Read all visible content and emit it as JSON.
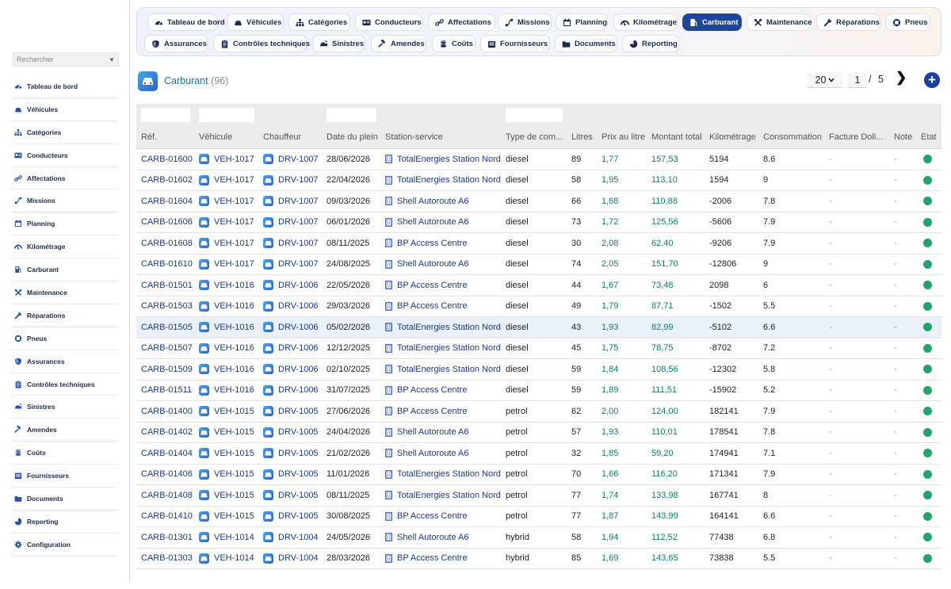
{
  "sidebar": {
    "search_placeholder": "Rechercher",
    "items": [
      {
        "label": "Tableau de bord",
        "icon": "dashboard-icon"
      },
      {
        "label": "Véhicules",
        "icon": "car-icon"
      },
      {
        "label": "Catégories",
        "icon": "sitemap-icon"
      },
      {
        "label": "Conducteurs",
        "icon": "id-card-icon"
      },
      {
        "label": "Affectations",
        "icon": "link-icon"
      },
      {
        "label": "Missions",
        "icon": "route-icon"
      },
      {
        "label": "Planning",
        "icon": "calendar-icon"
      },
      {
        "label": "Kilométrage",
        "icon": "gauge-icon"
      },
      {
        "label": "Carburant",
        "icon": "fuel-pump-icon"
      },
      {
        "label": "Maintenance",
        "icon": "tools-icon"
      },
      {
        "label": "Réparations",
        "icon": "wrench-icon"
      },
      {
        "label": "Pneus",
        "icon": "tire-icon"
      },
      {
        "label": "Assurances",
        "icon": "shield-icon"
      },
      {
        "label": "Contrôles techniques",
        "icon": "clipboard-icon"
      },
      {
        "label": "Sinistres",
        "icon": "car-crash-icon"
      },
      {
        "label": "Amendes",
        "icon": "gavel-icon"
      },
      {
        "label": "Coûts",
        "icon": "coins-icon"
      },
      {
        "label": "Fournisseurs",
        "icon": "warehouse-icon"
      },
      {
        "label": "Documents",
        "icon": "folder-icon"
      },
      {
        "label": "Reporting",
        "icon": "chart-pie-icon"
      },
      {
        "label": "Configuration",
        "icon": "gear-icon"
      }
    ]
  },
  "tabs": [
    {
      "label": "Tableau de bord",
      "icon": "dashboard-icon",
      "active": false
    },
    {
      "label": "Véhicules",
      "icon": "car-icon",
      "active": false
    },
    {
      "label": "Catégories",
      "icon": "sitemap-icon",
      "active": false
    },
    {
      "label": "Conducteurs",
      "icon": "id-card-icon",
      "active": false
    },
    {
      "label": "Affectations",
      "icon": "link-icon",
      "active": false
    },
    {
      "label": "Missions",
      "icon": "route-icon",
      "active": false
    },
    {
      "label": "Planning",
      "icon": "calendar-icon",
      "active": false
    },
    {
      "label": "Kilométrage",
      "icon": "gauge-icon",
      "active": false
    },
    {
      "label": "Carburant",
      "icon": "fuel-pump-icon",
      "active": true
    },
    {
      "label": "Maintenance",
      "icon": "tools-icon",
      "active": false
    },
    {
      "label": "Réparations",
      "icon": "wrench-icon",
      "active": false
    },
    {
      "label": "Pneus",
      "icon": "tire-icon",
      "active": false
    },
    {
      "label": "Assurances",
      "icon": "shield-icon",
      "active": false
    },
    {
      "label": "Contrôles techniques",
      "icon": "clipboard-icon",
      "active": false
    },
    {
      "label": "Sinistres",
      "icon": "car-crash-icon",
      "active": false
    },
    {
      "label": "Amendes",
      "icon": "gavel-icon",
      "active": false
    },
    {
      "label": "Coûts",
      "icon": "coins-icon",
      "active": false
    },
    {
      "label": "Fournisseurs",
      "icon": "warehouse-icon",
      "active": false
    },
    {
      "label": "Documents",
      "icon": "folder-icon",
      "active": false
    },
    {
      "label": "Reporting",
      "icon": "chart-pie-icon",
      "active": false
    }
  ],
  "page": {
    "title": "Carburant",
    "count": "(96)",
    "page_size": "20",
    "current_page": "1",
    "page_sep": "/",
    "total_pages": "5",
    "next_glyph": "❯",
    "add_glyph": "+"
  },
  "table": {
    "columns": [
      "Réf.",
      "Véhicule",
      "Chauffeur",
      "Date du plein",
      "Station-service",
      "Type de com...",
      "Litres",
      "Prix au litre",
      "Montant total",
      "Kilométrage",
      "Consommation",
      "Facture Doli...",
      "Note",
      "État"
    ],
    "status_color": "#21a36b",
    "rows": [
      {
        "ref": "CARB-01600",
        "vehicle": "VEH-1017",
        "driver": "DRV-1007",
        "date": "28/06/2026",
        "station": "TotalEnergies Station Nord",
        "fuel": "diesel",
        "liters": "89",
        "price": "1,77",
        "total": "157,53",
        "km": "5194",
        "conso": "8.6",
        "invoice": "-",
        "note": "-"
      },
      {
        "ref": "CARB-01602",
        "vehicle": "VEH-1017",
        "driver": "DRV-1007",
        "date": "22/04/2026",
        "station": "TotalEnergies Station Nord",
        "fuel": "diesel",
        "liters": "58",
        "price": "1,95",
        "total": "113,10",
        "km": "1594",
        "conso": "9",
        "invoice": "-",
        "note": "-"
      },
      {
        "ref": "CARB-01604",
        "vehicle": "VEH-1017",
        "driver": "DRV-1007",
        "date": "09/03/2026",
        "station": "Shell Autoroute A6",
        "fuel": "diesel",
        "liters": "66",
        "price": "1,68",
        "total": "110,88",
        "km": "-2006",
        "conso": "7.8",
        "invoice": "-",
        "note": "-"
      },
      {
        "ref": "CARB-01606",
        "vehicle": "VEH-1017",
        "driver": "DRV-1007",
        "date": "06/01/2026",
        "station": "Shell Autoroute A6",
        "fuel": "diesel",
        "liters": "73",
        "price": "1,72",
        "total": "125,56",
        "km": "-5606",
        "conso": "7.9",
        "invoice": "-",
        "note": "-"
      },
      {
        "ref": "CARB-01608",
        "vehicle": "VEH-1017",
        "driver": "DRV-1007",
        "date": "08/11/2025",
        "station": "BP Access Centre",
        "fuel": "diesel",
        "liters": "30",
        "price": "2,08",
        "total": "62,40",
        "km": "-9206",
        "conso": "7.9",
        "invoice": "-",
        "note": "-"
      },
      {
        "ref": "CARB-01610",
        "vehicle": "VEH-1017",
        "driver": "DRV-1007",
        "date": "24/08/2025",
        "station": "Shell Autoroute A6",
        "fuel": "diesel",
        "liters": "74",
        "price": "2,05",
        "total": "151,70",
        "km": "-12806",
        "conso": "9",
        "invoice": "-",
        "note": "-"
      },
      {
        "ref": "CARB-01501",
        "vehicle": "VEH-1016",
        "driver": "DRV-1006",
        "date": "22/05/2026",
        "station": "BP Access Centre",
        "fuel": "diesel",
        "liters": "44",
        "price": "1,67",
        "total": "73,48",
        "km": "2098",
        "conso": "6",
        "invoice": "-",
        "note": "-"
      },
      {
        "ref": "CARB-01503",
        "vehicle": "VEH-1016",
        "driver": "DRV-1006",
        "date": "29/03/2026",
        "station": "BP Access Centre",
        "fuel": "diesel",
        "liters": "49",
        "price": "1,79",
        "total": "87,71",
        "km": "-1502",
        "conso": "5.5",
        "invoice": "-",
        "note": "-"
      },
      {
        "ref": "CARB-01505",
        "vehicle": "VEH-1016",
        "driver": "DRV-1006",
        "date": "05/02/2026",
        "station": "TotalEnergies Station Nord",
        "fuel": "diesel",
        "liters": "43",
        "price": "1,93",
        "total": "82,99",
        "km": "-5102",
        "conso": "6.6",
        "invoice": "-",
        "note": "-"
      },
      {
        "ref": "CARB-01507",
        "vehicle": "VEH-1016",
        "driver": "DRV-1006",
        "date": "12/12/2025",
        "station": "TotalEnergies Station Nord",
        "fuel": "diesel",
        "liters": "45",
        "price": "1,75",
        "total": "78,75",
        "km": "-8702",
        "conso": "7.2",
        "invoice": "-",
        "note": "-"
      },
      {
        "ref": "CARB-01509",
        "vehicle": "VEH-1016",
        "driver": "DRV-1006",
        "date": "02/10/2025",
        "station": "TotalEnergies Station Nord",
        "fuel": "diesel",
        "liters": "59",
        "price": "1,84",
        "total": "108,56",
        "km": "-12302",
        "conso": "5.8",
        "invoice": "-",
        "note": "-"
      },
      {
        "ref": "CARB-01511",
        "vehicle": "VEH-1016",
        "driver": "DRV-1006",
        "date": "31/07/2025",
        "station": "BP Access Centre",
        "fuel": "diesel",
        "liters": "59",
        "price": "1,89",
        "total": "111,51",
        "km": "-15902",
        "conso": "5.2",
        "invoice": "-",
        "note": "-"
      },
      {
        "ref": "CARB-01400",
        "vehicle": "VEH-1015",
        "driver": "DRV-1005",
        "date": "27/06/2026",
        "station": "BP Access Centre",
        "fuel": "petrol",
        "liters": "62",
        "price": "2,00",
        "total": "124,00",
        "km": "182141",
        "conso": "7.9",
        "invoice": "-",
        "note": "-"
      },
      {
        "ref": "CARB-01402",
        "vehicle": "VEH-1015",
        "driver": "DRV-1005",
        "date": "24/04/2026",
        "station": "Shell Autoroute A6",
        "fuel": "petrol",
        "liters": "57",
        "price": "1,93",
        "total": "110,01",
        "km": "178541",
        "conso": "7.8",
        "invoice": "-",
        "note": "-"
      },
      {
        "ref": "CARB-01404",
        "vehicle": "VEH-1015",
        "driver": "DRV-1005",
        "date": "21/02/2026",
        "station": "Shell Autoroute A6",
        "fuel": "petrol",
        "liters": "32",
        "price": "1,85",
        "total": "59,20",
        "km": "174941",
        "conso": "7.1",
        "invoice": "-",
        "note": "-"
      },
      {
        "ref": "CARB-01406",
        "vehicle": "VEH-1015",
        "driver": "DRV-1005",
        "date": "11/01/2026",
        "station": "TotalEnergies Station Nord",
        "fuel": "petrol",
        "liters": "70",
        "price": "1,66",
        "total": "116,20",
        "km": "171341",
        "conso": "7.9",
        "invoice": "-",
        "note": "-"
      },
      {
        "ref": "CARB-01408",
        "vehicle": "VEH-1015",
        "driver": "DRV-1005",
        "date": "08/11/2025",
        "station": "TotalEnergies Station Nord",
        "fuel": "petrol",
        "liters": "77",
        "price": "1,74",
        "total": "133,98",
        "km": "167741",
        "conso": "8",
        "invoice": "-",
        "note": "-"
      },
      {
        "ref": "CARB-01410",
        "vehicle": "VEH-1015",
        "driver": "DRV-1005",
        "date": "30/08/2025",
        "station": "BP Access Centre",
        "fuel": "petrol",
        "liters": "77",
        "price": "1,87",
        "total": "143,99",
        "km": "164141",
        "conso": "6.6",
        "invoice": "-",
        "note": "-"
      },
      {
        "ref": "CARB-01301",
        "vehicle": "VEH-1014",
        "driver": "DRV-1004",
        "date": "24/05/2026",
        "station": "Shell Autoroute A6",
        "fuel": "hybrid",
        "liters": "58",
        "price": "1,94",
        "total": "112,52",
        "km": "77438",
        "conso": "6.8",
        "invoice": "-",
        "note": "-"
      },
      {
        "ref": "CARB-01303",
        "vehicle": "VEH-1014",
        "driver": "DRV-1004",
        "date": "28/03/2026",
        "station": "BP Access Centre",
        "fuel": "hybrid",
        "liters": "85",
        "price": "1,69",
        "total": "143,65",
        "km": "73838",
        "conso": "5.5",
        "invoice": "-",
        "note": "-"
      }
    ]
  }
}
